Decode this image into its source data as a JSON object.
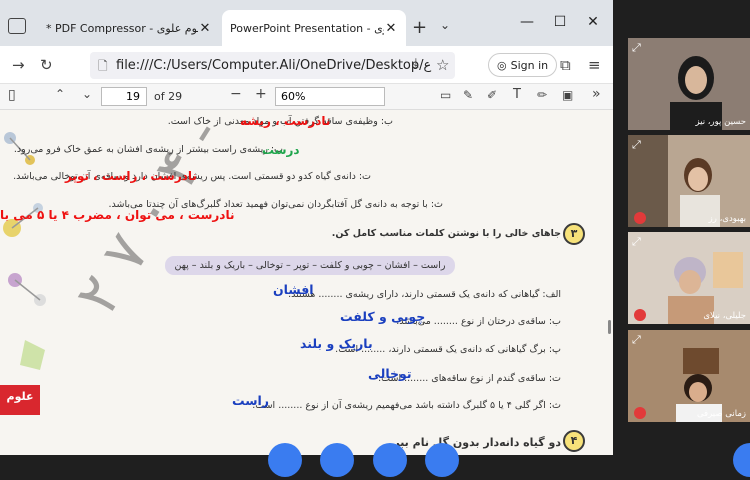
{
  "browser": {
    "tabs": [
      {
        "label": "* PDF Compressor - علوم علوی.pdf"
      },
      {
        "label": "PowerPoint Presentation - علوم علوی"
      }
    ],
    "address": "file:///C:/Users/Computer.Ali/OneDrive/Desktop/ع",
    "signin_label": "Sign in"
  },
  "pdf_toolbar": {
    "page_current": "19",
    "page_count": "of 29",
    "zoom": "60%"
  },
  "document": {
    "lines": [
      "ب: وظیفه‌ی ساقه گرفتن آب و مواد معدنی از خاک است.",
      "پ: ریشه‌ی راست بیشتر از ریشه‌ی افشان به عمق خاک فرو می‌رود.",
      "ت: دانه‌ی گیاه کدو دو قسمتی است. پس ریشه‌ی افشان دارد و ساقه‌ی آن توخالی می‌باشد.",
      "ث: با توجه به دانه‌ی گل آفتابگردان نمی‌توان فهمید تعداد گلبرگ‌های آن چندتا می‌باشد.",
      "جاهای خالی را با نوشتن کلمات مناسب کامل کن.",
      "الف: گیاهانی که دانه‌ی یک قسمتی دارند، دارای ریشه‌ی ........ هستند.",
      "ب: ساقه‌ی درختان از نوع ........ می‌باشد.",
      "پ: برگ گیاهانی که دانه‌ی یک قسمتی دارند، ........ است.",
      "ت: ساقه‌ی گندم از نوع ساقه‌های ........ است.",
      "ث: اگر گلی ۴ یا ۵ گلبرگ داشته باشد می‌فهمیم ریشه‌ی آن از نوع ........ است.",
      "دو گیاه دانه‌دار بدون گل نام ببر."
    ],
    "word_bank": "راست – افشان – چوبی و کلفت – توپر – توخالی – باریک و بلند – پهن",
    "question_numbers": [
      "۳",
      "۴"
    ],
    "handwritten_red": [
      "نادرست ، ریشه",
      "نادرست ، راست ، توپر",
      "نادرست ، می توان ، مضرب ۴ یا ۵ می با"
    ],
    "handwritten_green": "درست",
    "handwritten_blue": [
      "افشان",
      "چوبی و کلفت",
      "باریک و بلند",
      "توخالی",
      "راست"
    ],
    "watermark": "۱۴۲۴۰۱ - ۴ ۰ ۷ ۲",
    "logo": "علوم"
  },
  "participants": [
    {
      "name": "حسین پور، نیز"
    },
    {
      "name": "بهبودی، رز"
    },
    {
      "name": "جلیلی، نیلای"
    },
    {
      "name": "زمانی صیرفی"
    }
  ],
  "colors": {
    "accent": "#3a7cf0",
    "red_ink": "#e11111",
    "blue_ink": "#1a3fbf",
    "green_ink": "#1fa54c",
    "mic_muted": "#e23a3a"
  }
}
